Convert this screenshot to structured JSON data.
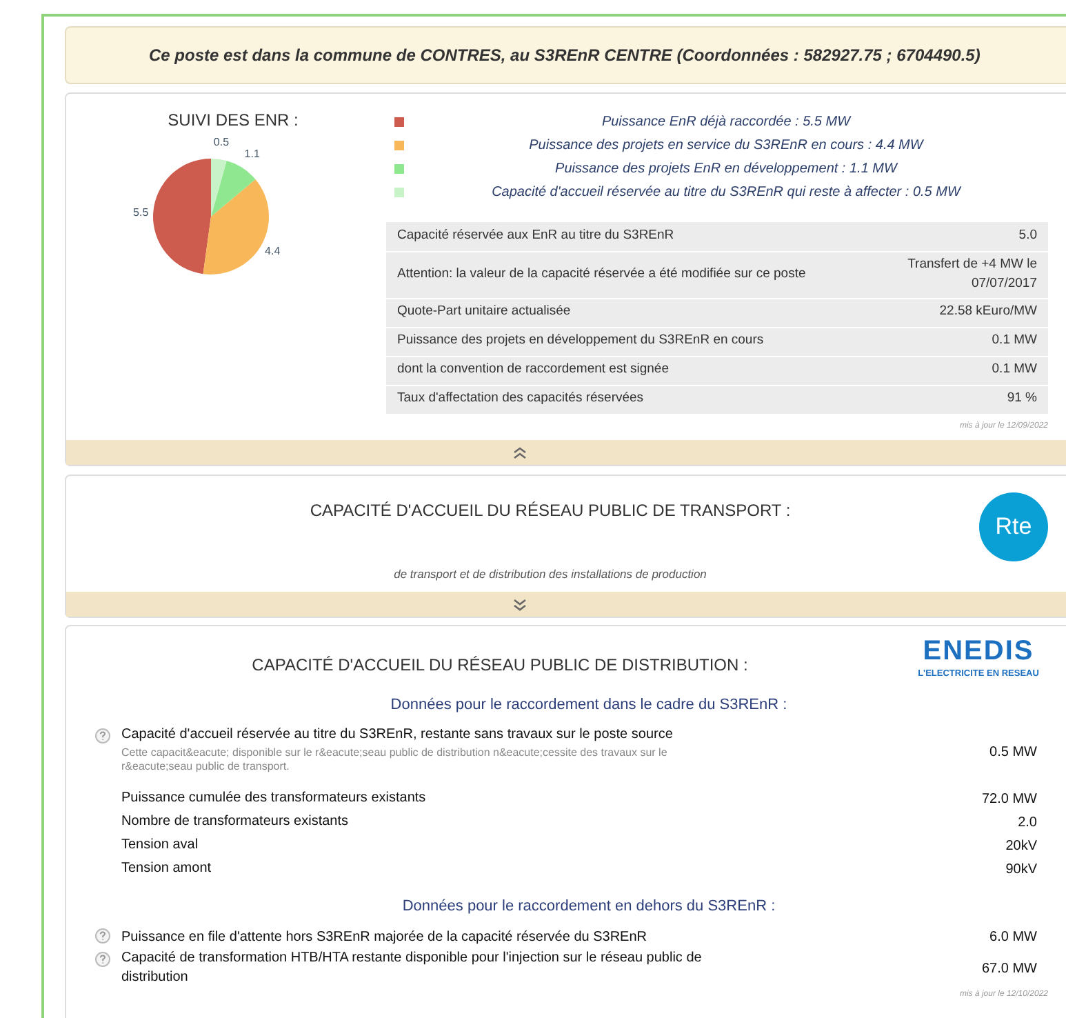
{
  "banner": {
    "text": "Ce poste est dans la commune de CONTRES, au S3REnR CENTRE (Coordonnées : 582927.75 ; 6704490.5)"
  },
  "enr": {
    "title": "SUIVI DES ENR :",
    "expanded": true,
    "legend": [
      {
        "label": "Puissance EnR déjà raccordée : 5.5 MW",
        "color": "#cd5c4e"
      },
      {
        "label": "Puissance des projets en service du S3REnR en cours : 4.4 MW",
        "color": "#f8b85a"
      },
      {
        "label": "Puissance des projets EnR en développement : 1.1 MW",
        "color": "#8fe88f"
      },
      {
        "label": "Capacité d'accueil réservée au titre du S3REnR qui reste à affecter : 0.5 MW",
        "color": "#c8f2c8"
      }
    ],
    "chart_data": {
      "type": "pie",
      "values": [
        5.5,
        4.4,
        1.1,
        0.5
      ],
      "data_labels": true,
      "value_labels": [
        "5.5",
        "4.4",
        "1.1",
        "0.5"
      ]
    },
    "rows": [
      {
        "label": "Capacité réservée aux EnR au titre du S3REnR",
        "value": "5.0"
      },
      {
        "label": "Attention: la valeur de la capacité réservée a été modifiée sur ce poste",
        "value": "Transfert de +4 MW le 07/07/2017"
      },
      {
        "label": "Quote-Part unitaire actualisée",
        "value": "22.58 kEuro/MW"
      },
      {
        "label": "Puissance des projets en développement du S3REnR en cours",
        "value": "0.1 MW"
      },
      {
        "label": "dont la convention de raccordement est signée",
        "value": "0.1 MW"
      },
      {
        "label": "Taux d'affectation des capacités réservées",
        "value": "91 %"
      }
    ],
    "updated": "mis à jour le 12/09/2022"
  },
  "transport": {
    "title": "CAPACITÉ D'ACCUEIL DU RÉSEAU PUBLIC DE TRANSPORT :",
    "logo": "Rte",
    "subtitle": "de transport et de distribution des installations de production",
    "expanded": false
  },
  "distribution": {
    "title": "CAPACITÉ D'ACCUEIL DU RÉSEAU PUBLIC DE DISTRIBUTION :",
    "logo": {
      "text": "ENEDIS",
      "tagline": "L'ELECTRICITE EN RESEAU"
    },
    "sections": [
      {
        "heading": "Données pour le raccordement dans le cadre du S3REnR :",
        "rows": [
          {
            "help": true,
            "label": "Capacité d'accueil réservée au titre du S3REnR, restante sans travaux sur le poste source",
            "note": "Cette capacit&eacute; disponible sur le r&eacute;seau public de distribution n&eacute;cessite des travaux sur le r&eacute;seau public de transport.",
            "value": "0.5 MW"
          },
          {
            "help": false,
            "label": "Puissance cumulée des transformateurs existants",
            "value": "72.0 MW"
          },
          {
            "help": false,
            "label": "Nombre de transformateurs existants",
            "value": "2.0"
          },
          {
            "help": false,
            "label": "Tension aval",
            "value": "20kV"
          },
          {
            "help": false,
            "label": "Tension amont",
            "value": "90kV"
          }
        ]
      },
      {
        "heading": "Données pour le raccordement en dehors du S3REnR :",
        "rows": [
          {
            "help": true,
            "label": "Puissance en file d'attente hors S3REnR majorée de la capacité réservée du S3REnR",
            "value": "6.0 MW"
          },
          {
            "help": true,
            "label": "Capacité de transformation HTB/HTA restante disponible pour l'injection sur le réseau public de distribution",
            "value": "67.0 MW"
          }
        ]
      }
    ],
    "updated": "mis à jour le 12/10/2022"
  }
}
